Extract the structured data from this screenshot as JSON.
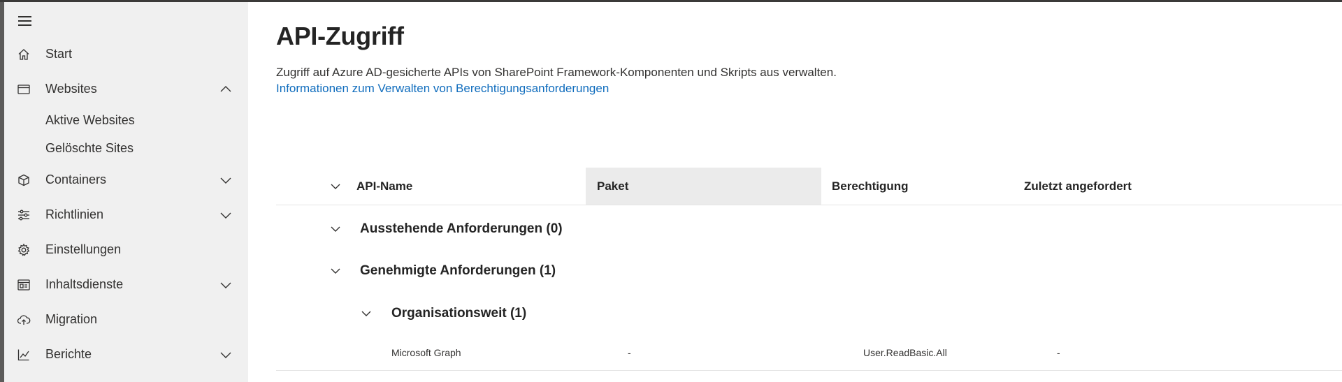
{
  "sidebar": {
    "items": [
      {
        "id": "start",
        "label": "Start",
        "icon": "home-icon",
        "chevron": null
      },
      {
        "id": "websites",
        "label": "Websites",
        "icon": "website-icon",
        "chevron": "chevron-up-icon"
      },
      {
        "id": "containers",
        "label": "Containers",
        "icon": "cube-icon",
        "chevron": "chevron-down-icon"
      },
      {
        "id": "richtlinien",
        "label": "Richtlinien",
        "icon": "sliders-icon",
        "chevron": "chevron-down-icon"
      },
      {
        "id": "einstellungen",
        "label": "Einstellungen",
        "icon": "gear-icon",
        "chevron": null
      },
      {
        "id": "inhaltsdienste",
        "label": "Inhaltsdienste",
        "icon": "content-services-icon",
        "chevron": "chevron-down-icon"
      },
      {
        "id": "migration",
        "label": "Migration",
        "icon": "cloud-upload-icon",
        "chevron": null
      },
      {
        "id": "berichte",
        "label": "Berichte",
        "icon": "line-chart-icon",
        "chevron": "chevron-down-icon"
      }
    ],
    "subitems": [
      "Aktive Websites",
      "Gelöschte Sites"
    ]
  },
  "main": {
    "title": "API-Zugriff",
    "description": "Zugriff auf Azure AD-gesicherte APIs von SharePoint Framework-Komponenten und Skripts aus verwalten.",
    "link": "Informationen zum Verwalten von Berechtigungsanforderungen"
  },
  "table": {
    "columns": [
      "API-Name",
      "Paket",
      "Berechtigung",
      "Zuletzt angefordert"
    ],
    "active_column": "Paket",
    "groups": [
      {
        "label": "Ausstehende Anforderungen (0)",
        "expanded": true
      },
      {
        "label": "Genehmigte Anforderungen (1)",
        "expanded": true
      }
    ],
    "subgroup": {
      "label": "Organisationsweit (1)",
      "expanded": true
    },
    "rows": [
      {
        "api_name": "Microsoft Graph",
        "package": "-",
        "permission": "User.ReadBasic.All",
        "last_requested": "-"
      }
    ]
  },
  "colors": {
    "accent": "#0f6cbd",
    "sidebar_bg": "#f0f0f0",
    "text": "#323130",
    "active_header_bg": "#ebebeb"
  }
}
